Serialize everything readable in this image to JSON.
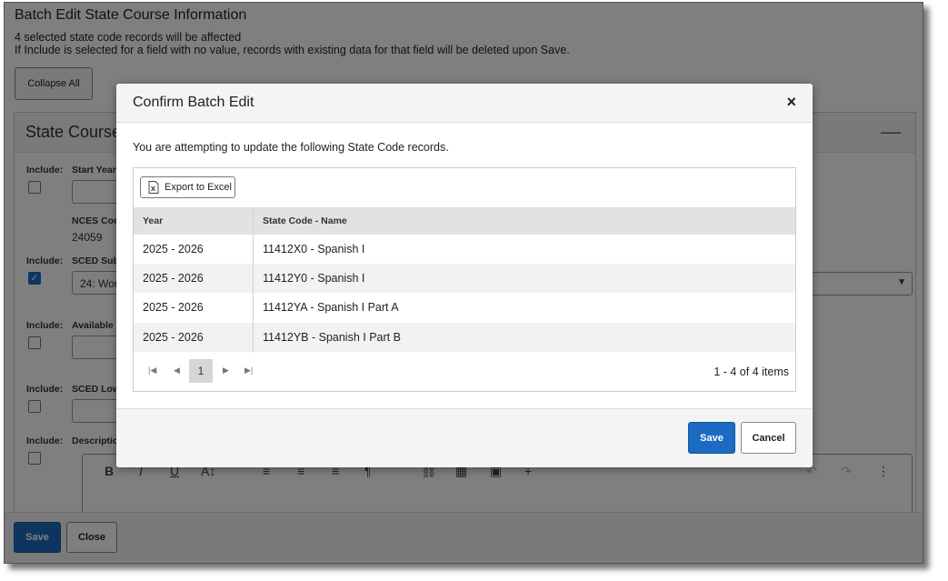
{
  "background": {
    "title": "Batch Edit State Course Information",
    "line1": "4 selected state code records will be affected",
    "line2": "If Include is selected for a field with no value, records with existing data for that field will be deleted upon Save.",
    "collapse_all": "Collapse All",
    "panel_title": "State Course",
    "include_label": "Include:",
    "fields": {
      "start_year": "Start Year",
      "nces_code": "NCES Cod",
      "nces_value": "24059",
      "sced_subject": "SCED Subj",
      "sced_subject_value": "24: Wor",
      "available": "Available",
      "sced_low": "SCED Low",
      "description": "Descriptio"
    },
    "save": "Save",
    "close": "Close"
  },
  "modal": {
    "title": "Confirm Batch Edit",
    "close_icon": "×",
    "message": "You are attempting to update the following State Code records.",
    "export_label": "Export to Excel",
    "columns": [
      "Year",
      "State Code - Name"
    ],
    "rows": [
      {
        "year": "2025 - 2026",
        "name": "11412X0 - Spanish I"
      },
      {
        "year": "2025 - 2026",
        "name": "11412Y0 - Spanish I"
      },
      {
        "year": "2025 - 2026",
        "name": "11412YA - Spanish I Part A"
      },
      {
        "year": "2025 - 2026",
        "name": "11412YB - Spanish I Part B"
      }
    ],
    "pager": {
      "current_page": "1",
      "info": "1 - 4 of 4 items"
    },
    "save": "Save",
    "cancel": "Cancel"
  },
  "colors": {
    "primary": "#1a6bc1",
    "overlay": "rgba(0,0,0,0.5)"
  }
}
